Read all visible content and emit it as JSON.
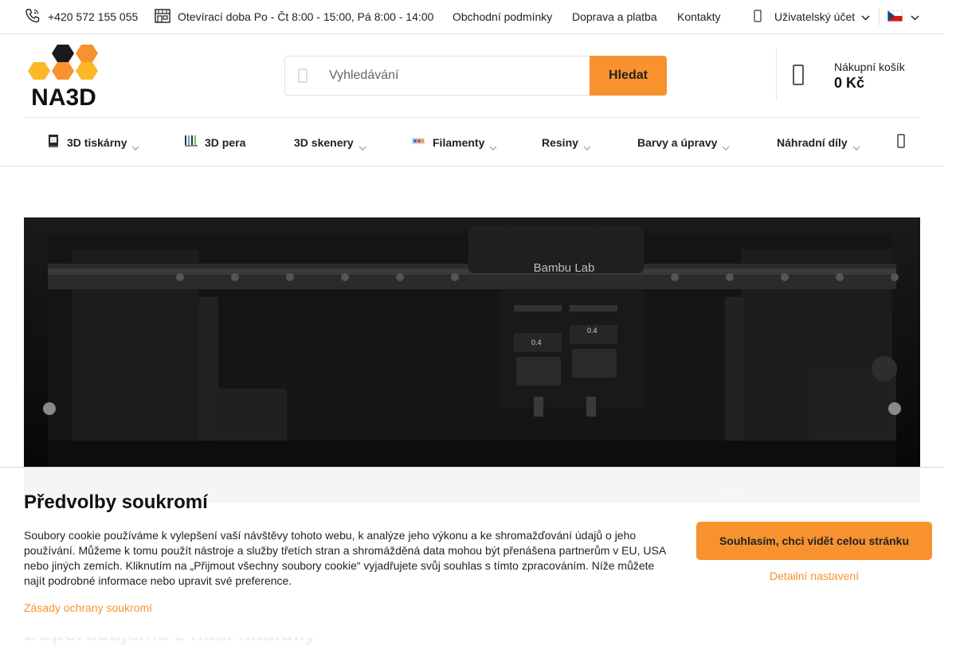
{
  "topbar": {
    "phone": "+420 572 155 055",
    "opening_hours": "Otevírací doba Po - Čt 8:00 - 15:00, Pá 8:00 - 14:00",
    "links": [
      "Obchodní podmínky",
      "Doprava a platba",
      "Kontakty"
    ],
    "account_label": "Uživatelský účet",
    "language": "CZ"
  },
  "header": {
    "logo_text": "NA3D",
    "search": {
      "placeholder": "Vyhledávání",
      "button_label": "Hledat"
    },
    "cart": {
      "label": "Nákupní košík",
      "value": "0 Kč"
    }
  },
  "nav": {
    "items": [
      {
        "label": "3D tiskárny",
        "icon": "printer-thumbnail",
        "has_dropdown": true
      },
      {
        "label": "3D pera",
        "icon": "pens-thumbnail",
        "has_dropdown": false
      },
      {
        "label": "3D skenery",
        "icon": "",
        "has_dropdown": true
      },
      {
        "label": "Filamenty",
        "icon": "filament-thumbnail",
        "has_dropdown": true
      },
      {
        "label": "Resiny",
        "icon": "",
        "has_dropdown": true
      },
      {
        "label": "Barvy a úpravy",
        "icon": "",
        "has_dropdown": true
      },
      {
        "label": "Náhradní díly",
        "icon": "",
        "has_dropdown": true
      }
    ],
    "more_icon": "menu-icon"
  },
  "hero": {
    "brand_text": "Bambu Lab",
    "nozzle_labels": [
      "0.4",
      "0.4"
    ]
  },
  "cookie_banner": {
    "title": "Předvolby soukromí",
    "text": "Soubory cookie používáme k vylepšení vaší návštěvy tohoto webu, k analýze jeho výkonu a ke shromažďování údajů o jeho používání. Můžeme k tomu použít nástroje a služby třetích stran a shromážděná data mohou být přenášena partnerům v EU, USA nebo jiných zemích. Kliknutím na „Přijmout všechny soubory cookie“ vyjadřujete svůj souhlas s tímto zpracováním. Níže můžete najít podrobné informace nebo upravit své preference.",
    "privacy_link": "Zásady ochrany soukromí",
    "accept_button": "Souhlasím, chci vidět celou stránku",
    "settings_link": "Detailní nastavení"
  },
  "behind_section_title": "Doporučujeme z naší nabídky",
  "colors": {
    "accent": "#f7922e",
    "logo_black": "#1a1a1a",
    "logo_orange": "#f7922e",
    "logo_yellow": "#fbb829"
  }
}
